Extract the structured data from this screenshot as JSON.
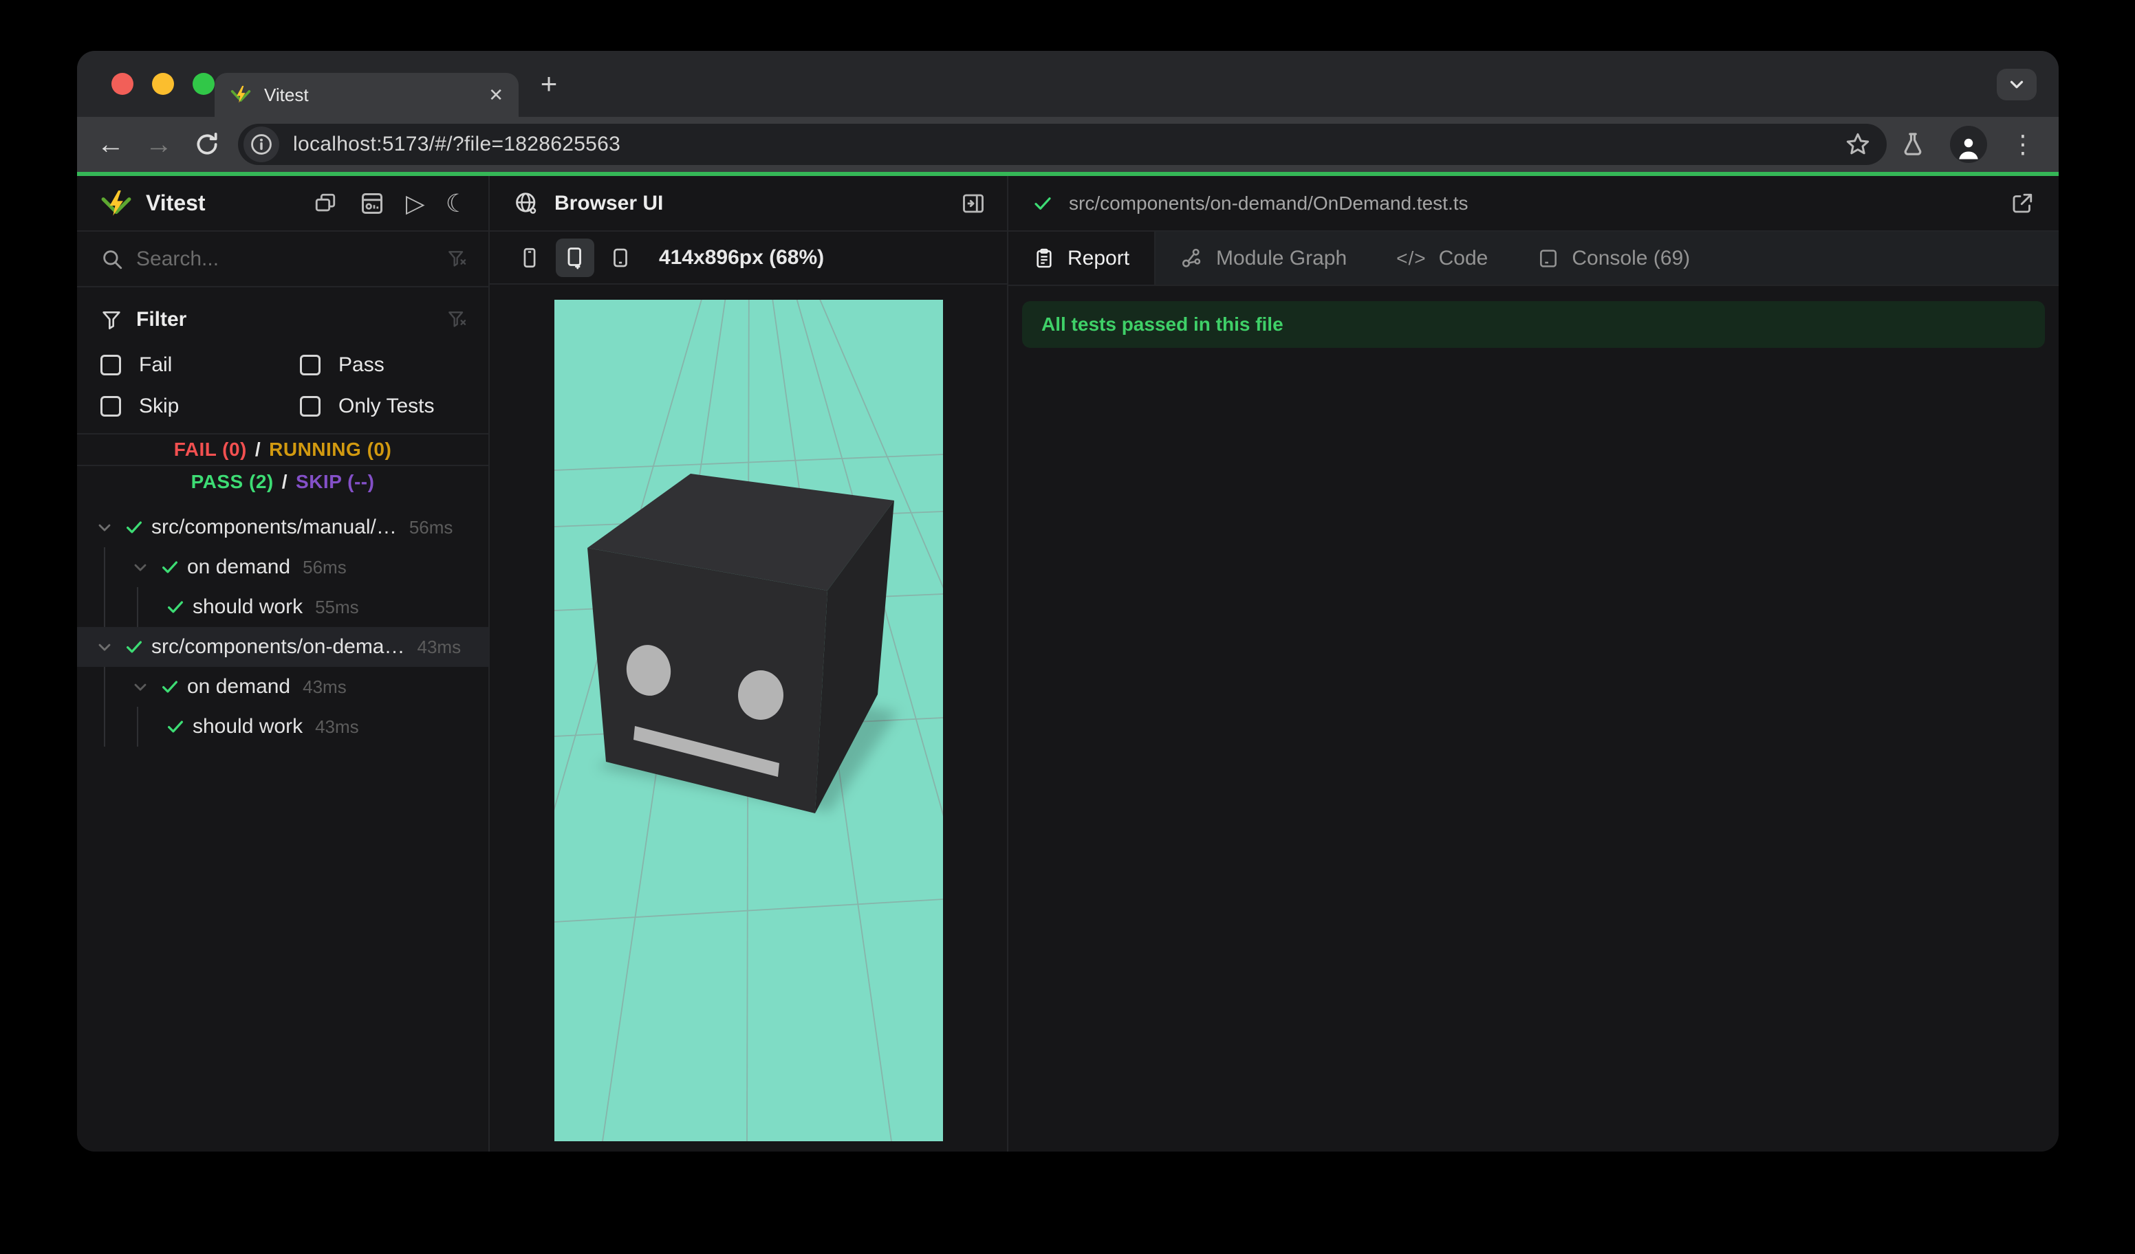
{
  "browser": {
    "tab_title": "Vitest",
    "url": "localhost:5173/#/?file=1828625563"
  },
  "glyphs": {
    "plus": "+",
    "close": "✕",
    "kebab": "⋮",
    "back": "←",
    "forward": "→",
    "play": "▷",
    "moon": "☾",
    "code": "</>"
  },
  "sidebar": {
    "app_title": "Vitest",
    "search_placeholder": "Search...",
    "filter": {
      "title": "Filter",
      "options": [
        "Fail",
        "Pass",
        "Skip",
        "Only Tests"
      ]
    },
    "status": {
      "fail": "FAIL (0)",
      "running": "RUNNING (0)",
      "pass": "PASS (2)",
      "skip": "SKIP (--)",
      "separator": "/"
    },
    "tree": [
      {
        "label": "src/components/manual/…",
        "duration": "56ms",
        "level": 0
      },
      {
        "label": "on demand",
        "duration": "56ms",
        "level": 1
      },
      {
        "label": "should work",
        "duration": "55ms",
        "level": 2
      },
      {
        "label": "src/components/on-dema…",
        "duration": "43ms",
        "level": 0
      },
      {
        "label": "on demand",
        "duration": "43ms",
        "level": 1
      },
      {
        "label": "should work",
        "duration": "43ms",
        "level": 2
      }
    ]
  },
  "preview": {
    "title": "Browser UI",
    "dimensions": "414x896px (68%)"
  },
  "detail": {
    "file_path": "src/components/on-demand/OnDemand.test.ts",
    "tabs": [
      {
        "label": "Report"
      },
      {
        "label": "Module Graph"
      },
      {
        "label": "Code"
      },
      {
        "label": "Console (69)"
      }
    ],
    "banner": "All tests passed in this file"
  },
  "colors": {
    "accent_green": "#35b757",
    "pass_green": "#3ddc74",
    "fail_red": "#f25050",
    "running_yellow": "#d29a10",
    "skip_purple": "#8450c8",
    "viewport_teal": "#7fdcc5",
    "banner_bg": "#152a1c",
    "banner_text": "#3fd068",
    "traffic_red": "#f25f58",
    "traffic_yellow": "#fbbe2e",
    "traffic_green": "#31c748"
  }
}
